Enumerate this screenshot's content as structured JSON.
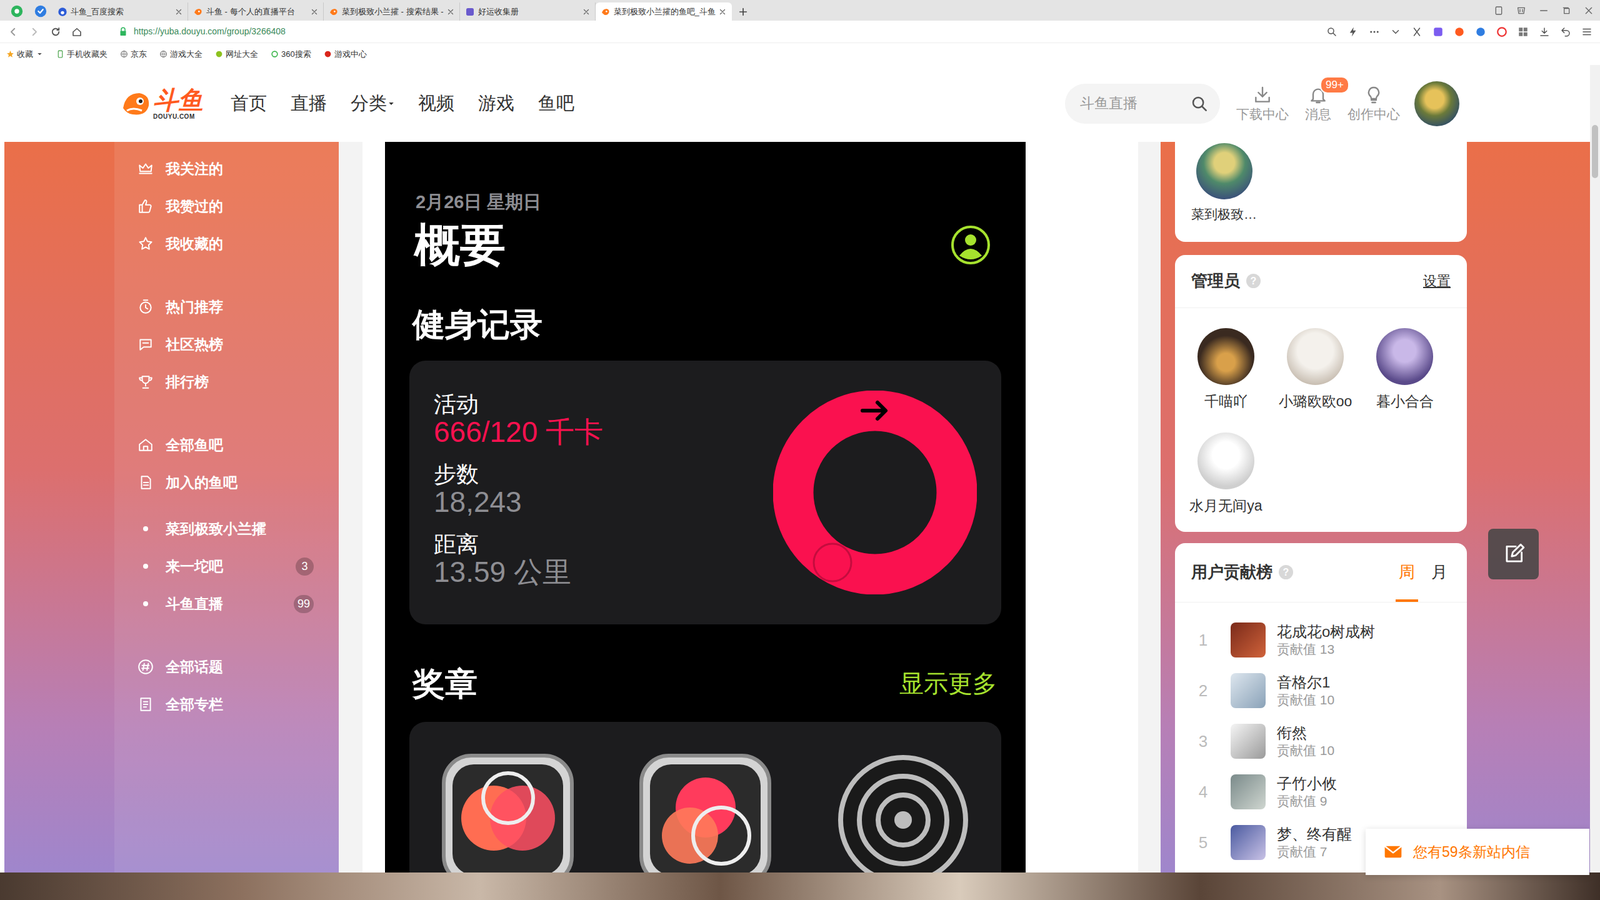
{
  "browser": {
    "tabs": [
      {
        "label": "斗鱼_百度搜索",
        "selected": false
      },
      {
        "label": "斗鱼 - 每个人的直播平台",
        "selected": false
      },
      {
        "label": "菜到极致小兰攉 - 搜索结果 -",
        "selected": false
      },
      {
        "label": "好运收集册",
        "selected": false
      },
      {
        "label": "菜到极致小兰攉的鱼吧_斗鱼",
        "selected": true
      }
    ],
    "url": "https://yuba.douyu.com/group/3266408",
    "bookmarks": [
      "收藏",
      "手机收藏夹",
      "京东",
      "游戏大全",
      "网址大全",
      "360搜索",
      "游戏中心"
    ]
  },
  "header": {
    "logo": "斗鱼",
    "logo_sub": "DOUYU.COM",
    "nav": [
      {
        "label": "首页",
        "dropdown": false
      },
      {
        "label": "直播",
        "dropdown": false
      },
      {
        "label": "分类",
        "dropdown": true
      },
      {
        "label": "视频",
        "dropdown": false
      },
      {
        "label": "游戏",
        "dropdown": false
      },
      {
        "label": "鱼吧",
        "dropdown": false
      }
    ],
    "search": {
      "placeholder": "斗鱼直播"
    },
    "tools": [
      {
        "label": "下载中心"
      },
      {
        "label": "消息",
        "badge": "99+"
      },
      {
        "label": "创作中心"
      }
    ]
  },
  "sidebar": {
    "groups": [
      {
        "items": [
          {
            "label": "我关注的",
            "kind": "link"
          },
          {
            "label": "我赞过的",
            "kind": "link"
          },
          {
            "label": "我收藏的",
            "kind": "link"
          }
        ]
      },
      {
        "items": [
          {
            "label": "热门推荐",
            "kind": "link"
          },
          {
            "label": "社区热榜",
            "kind": "link"
          },
          {
            "label": "排行榜",
            "kind": "link"
          }
        ]
      },
      {
        "items": [
          {
            "label": "全部鱼吧",
            "kind": "link"
          },
          {
            "label": "加入的鱼吧",
            "kind": "link"
          },
          {
            "label": "菜到极致小兰攉",
            "kind": "sub"
          },
          {
            "label": "来一坨吧",
            "kind": "sub",
            "count": "3"
          },
          {
            "label": "斗鱼直播",
            "kind": "sub",
            "count": "99"
          }
        ]
      },
      {
        "items": [
          {
            "label": "全部话题",
            "kind": "link"
          },
          {
            "label": "全部专栏",
            "kind": "link"
          }
        ]
      }
    ]
  },
  "post": {
    "date": "2月26日 星期日",
    "title": "概要",
    "records_title": "健身记录",
    "stats": [
      {
        "label": "活动",
        "value": "666/120 千卡",
        "kind": "activity"
      },
      {
        "label": "步数",
        "value": "18,243",
        "kind": "plain"
      },
      {
        "label": "距离",
        "value": "13.59 公里",
        "kind": "plain"
      }
    ],
    "ring": {
      "level": 1
    },
    "medals_title": "奖章",
    "more": "显示更多"
  },
  "group": {
    "name": "菜到极致…"
  },
  "admins": {
    "title": "管理员",
    "help": "?",
    "action": "设置",
    "members": [
      {
        "name": "千喵吖"
      },
      {
        "name": "小璐欧欧oo"
      },
      {
        "name": "暮小合合"
      },
      {
        "name": "水月无间ya"
      }
    ]
  },
  "ranking": {
    "title": "用户贡献榜",
    "help": "?",
    "tabs": [
      {
        "label": "周",
        "selected": true
      },
      {
        "label": "月",
        "selected": false
      }
    ],
    "rows": [
      {
        "rank": "1",
        "name": "花成花o树成树",
        "score": "贡献值 13"
      },
      {
        "rank": "2",
        "name": "音格尔1",
        "score": "贡献值 10"
      },
      {
        "rank": "3",
        "name": "衔然",
        "score": "贡献值 10"
      },
      {
        "rank": "4",
        "name": "子竹小攸",
        "score": "贡献值 9"
      },
      {
        "rank": "5",
        "name": "梦、终有醒",
        "score": "贡献值 7"
      }
    ]
  },
  "message": {
    "text": "您有59条新站内信"
  }
}
